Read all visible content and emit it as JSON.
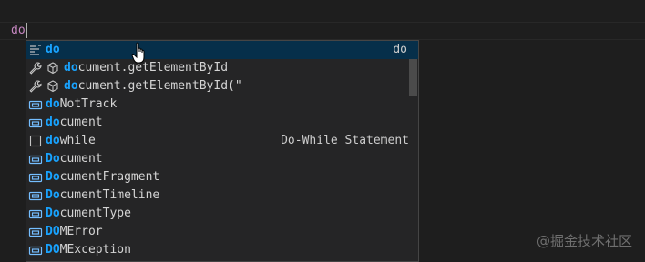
{
  "editor": {
    "typed_text": "do"
  },
  "suggest": {
    "items": [
      {
        "prefix": "do",
        "rest": "",
        "detail": "do",
        "kind": "snippet-icon",
        "kind2": ""
      },
      {
        "prefix": "do",
        "rest": "cument.getElementById",
        "detail": "",
        "kind": "wrench-icon",
        "kind2": "cube-icon"
      },
      {
        "prefix": "do",
        "rest": "cument.getElementById(\"",
        "detail": "",
        "kind": "wrench-icon",
        "kind2": "cube-icon"
      },
      {
        "prefix": "do",
        "rest": "NotTrack",
        "detail": "",
        "kind": "variable-icon",
        "kind2": ""
      },
      {
        "prefix": "do",
        "rest": "cument",
        "detail": "",
        "kind": "variable-icon",
        "kind2": ""
      },
      {
        "prefix": "do",
        "rest": "while",
        "detail": "Do-While Statement",
        "kind": "keyword-icon",
        "kind2": ""
      },
      {
        "prefix": "Do",
        "rest": "cument",
        "detail": "",
        "kind": "variable-icon",
        "kind2": ""
      },
      {
        "prefix": "Do",
        "rest": "cumentFragment",
        "detail": "",
        "kind": "variable-icon",
        "kind2": ""
      },
      {
        "prefix": "Do",
        "rest": "cumentTimeline",
        "detail": "",
        "kind": "variable-icon",
        "kind2": ""
      },
      {
        "prefix": "Do",
        "rest": "cumentType",
        "detail": "",
        "kind": "variable-icon",
        "kind2": ""
      },
      {
        "prefix": "DO",
        "rest": "MError",
        "detail": "",
        "kind": "variable-icon",
        "kind2": ""
      },
      {
        "prefix": "DO",
        "rest": "MException",
        "detail": "",
        "kind": "variable-icon",
        "kind2": ""
      }
    ]
  },
  "watermark": "@掘金技术社区",
  "colors": {
    "highlight": "#18a3ff",
    "selected_bg": "#062f4a",
    "keyword": "#c586c0",
    "variable_icon": "#75beff"
  }
}
